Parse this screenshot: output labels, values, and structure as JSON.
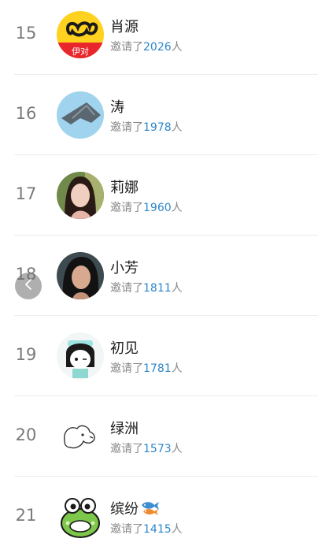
{
  "ranking": {
    "items": [
      {
        "rank": "15",
        "name": "肖源",
        "invite_prefix": "邀请了",
        "count": "2026",
        "invite_suffix": "人",
        "avatar": "yidui-logo"
      },
      {
        "rank": "16",
        "name": "涛",
        "invite_prefix": "邀请了",
        "count": "1978",
        "invite_suffix": "人",
        "avatar": "stealth-jet"
      },
      {
        "rank": "17",
        "name": "莉娜",
        "invite_prefix": "邀请了",
        "count": "1960",
        "invite_suffix": "人",
        "avatar": "girl-portrait"
      },
      {
        "rank": "18",
        "name": "小芳",
        "invite_prefix": "邀请了",
        "count": "1811",
        "invite_suffix": "人",
        "avatar": "girl-portrait-dark"
      },
      {
        "rank": "19",
        "name": "初见",
        "invite_prefix": "邀请了",
        "count": "1781",
        "invite_suffix": "人",
        "avatar": "cartoon-girl"
      },
      {
        "rank": "20",
        "name": "绿洲",
        "invite_prefix": "邀请了",
        "count": "1573",
        "invite_suffix": "人",
        "avatar": "dog-sketch"
      },
      {
        "rank": "21",
        "name": "缤纷",
        "invite_prefix": "邀请了",
        "count": "1415",
        "invite_suffix": "人",
        "avatar": "frog-cartoon",
        "name_emoji": "fish-icon"
      }
    ]
  },
  "back_button": {
    "icon": "chevron-left-icon"
  },
  "colors": {
    "count": "#2d86c8",
    "rank": "#7a7a7a",
    "divider": "#ececec"
  }
}
